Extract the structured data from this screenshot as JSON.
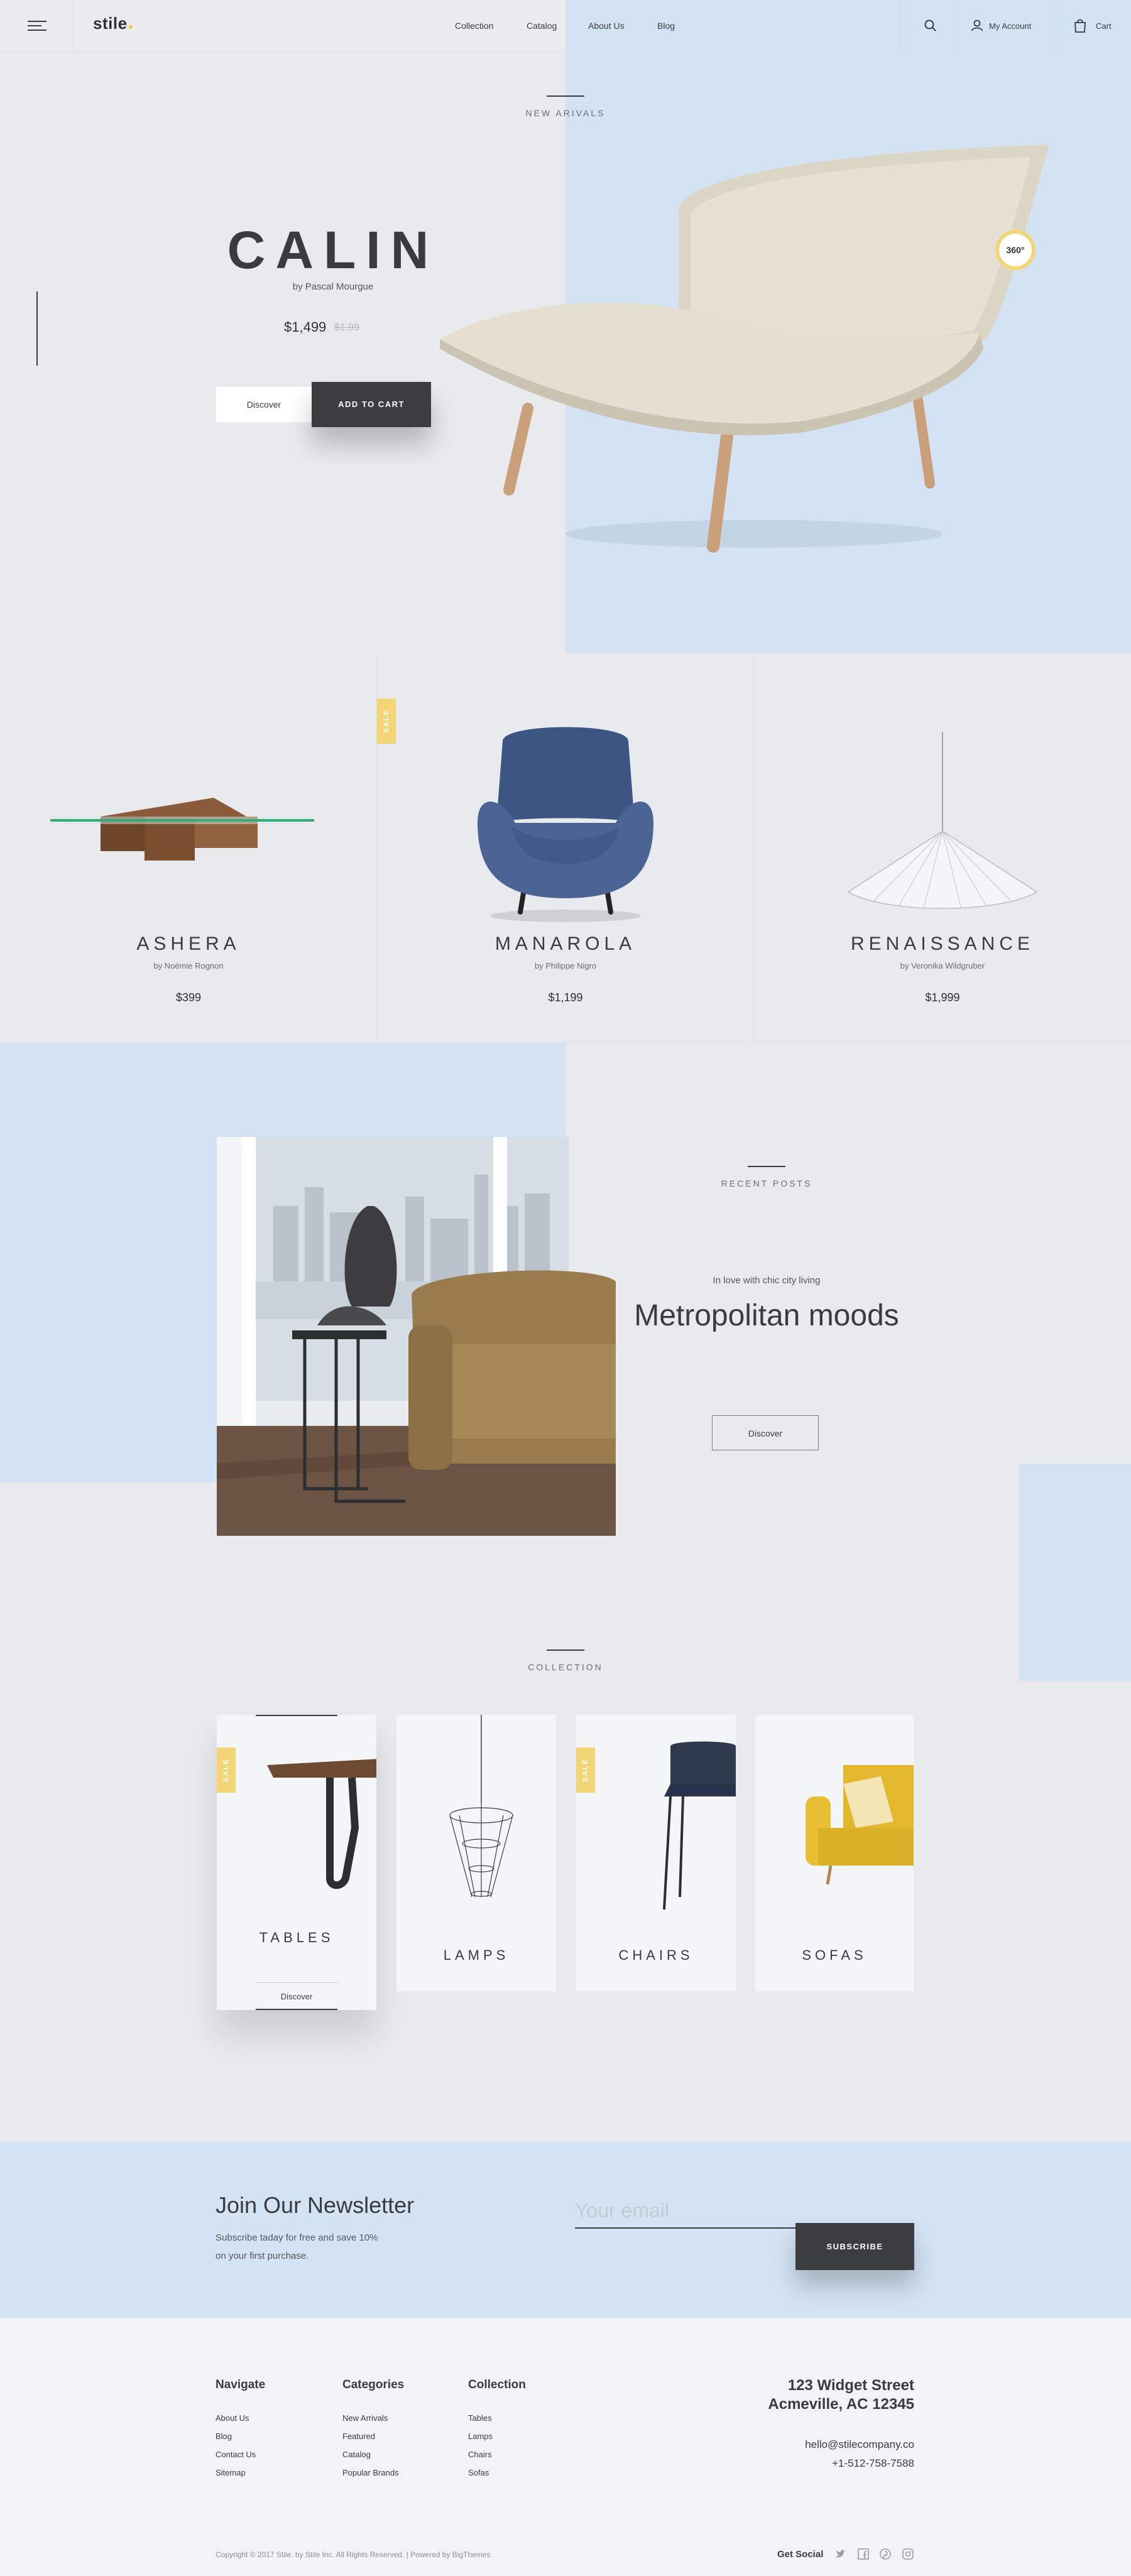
{
  "header": {
    "logo": "stile",
    "nav": [
      "Collection",
      "Catalog",
      "About Us",
      "Blog"
    ],
    "account_label": "My Account",
    "cart_label": "Cart",
    "accent_color": "#f2c94c",
    "icons": [
      "menu-icon",
      "search-icon",
      "user-icon",
      "cart-icon"
    ]
  },
  "hero": {
    "eyebrow": "NEW ARIVALS",
    "title": "CALIN",
    "by": "by Pascal Mourgue",
    "price": "$1,499",
    "old_price": "$1,99",
    "discover_label": "Discover",
    "add_to_cart_label": "ADD TO CART",
    "badge": "360°",
    "accent_blue": "#d3e3f3"
  },
  "products": [
    {
      "name": "ASHERA",
      "by": "by Noémie Rognon",
      "price": "$399",
      "sale": false
    },
    {
      "name": "MANAROLA",
      "by": "by Philippe Nigro",
      "price": "$1,199",
      "sale": true,
      "sale_label": "SALE"
    },
    {
      "name": "RENAISSANCE",
      "by": "by Veronika Wildgruber",
      "price": "$1,999",
      "sale": false
    }
  ],
  "recent_posts": {
    "eyebrow": "RECENT POSTS",
    "subtitle": "In love with chic city living",
    "title": "Metropolitan moods",
    "discover_label": "Discover"
  },
  "collection": {
    "eyebrow": "COLLECTION",
    "items": [
      {
        "label": "TABLES",
        "sale": true,
        "sale_label": "SALE",
        "active": true,
        "discover_label": "Discover"
      },
      {
        "label": "LAMPS",
        "sale": false
      },
      {
        "label": "CHAIRS",
        "sale": true,
        "sale_label": "SALE"
      },
      {
        "label": "SOFAS",
        "sale": false
      }
    ]
  },
  "newsletter": {
    "title": "Join Our Newsletter",
    "desc_line1": "Subscribe taday for free and save 10%",
    "desc_line2": "on your first purchase.",
    "placeholder": "Your email",
    "button": "SUBSCRIBE"
  },
  "footer": {
    "columns": [
      {
        "title": "Navigate",
        "items": [
          "About Us",
          "Blog",
          "Contact Us",
          "Sitemap"
        ]
      },
      {
        "title": "Categories",
        "items": [
          "New Arrivals",
          "Featured",
          "Catalog",
          "Popular Brands"
        ]
      },
      {
        "title": "Collection",
        "items": [
          "Tables",
          "Lamps",
          "Chairs",
          "Sofas"
        ]
      }
    ],
    "address_line1": "123 Widget Street",
    "address_line2": "Acmeville, AC 12345",
    "email": "hello@stilecompany.co",
    "phone": "+1-512-758-7588",
    "copyright": "Copyright © 2017 Stile. by Stile Inc. All Rights Reserved. | Powered by BigThemes",
    "social_label": "Get Social",
    "social_icons": [
      "twitter-icon",
      "facebook-icon",
      "pinterest-icon",
      "instagram-icon"
    ]
  }
}
